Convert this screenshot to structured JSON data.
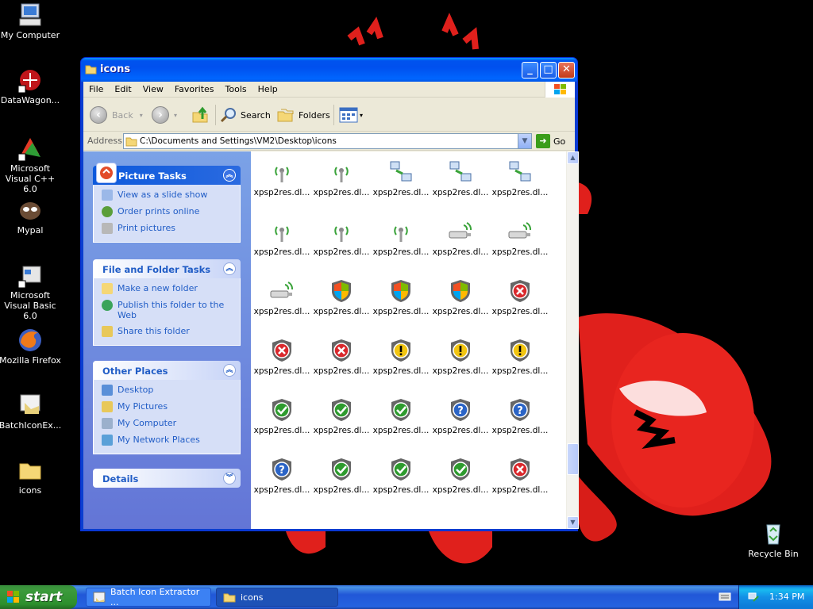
{
  "desktop": {
    "icons": [
      {
        "label": "My Computer"
      },
      {
        "label": "DataWagon..."
      },
      {
        "label": "Microsoft Visual C++ 6.0"
      },
      {
        "label": "Mypal"
      },
      {
        "label": "Microsoft Visual Basic 6.0"
      },
      {
        "label": "Mozilla Firefox"
      },
      {
        "label": "BatchIconEx..."
      },
      {
        "label": "icons"
      }
    ],
    "recycle_bin": "Recycle Bin"
  },
  "window": {
    "title": "icons",
    "menu": [
      "File",
      "Edit",
      "View",
      "Favorites",
      "Tools",
      "Help"
    ],
    "toolbar": {
      "back": "Back",
      "search": "Search",
      "folders": "Folders"
    },
    "address": {
      "label": "Address",
      "value": "C:\\Documents and Settings\\VM2\\Desktop\\icons",
      "go": "Go"
    }
  },
  "taskpane": {
    "picture_tasks": {
      "title": "Picture Tasks",
      "items": [
        "View as a slide show",
        "Order prints online",
        "Print pictures"
      ]
    },
    "file_folder_tasks": {
      "title": "File and Folder Tasks",
      "items": [
        "Make a new folder",
        "Publish this folder to the Web",
        "Share this folder"
      ]
    },
    "other_places": {
      "title": "Other Places",
      "items": [
        "Desktop",
        "My Pictures",
        "My Computer",
        "My Network Places"
      ]
    },
    "details": {
      "title": "Details"
    }
  },
  "files": {
    "label": "xpsp2res.dl...",
    "icon_kinds": [
      "antenna",
      "antenna",
      "network",
      "network",
      "network",
      "antenna",
      "antenna",
      "antenna",
      "usb-wireless",
      "usb-wireless",
      "usb-wireless",
      "shield-color",
      "shield-color",
      "shield-color",
      "shield-red",
      "shield-red",
      "shield-red",
      "shield-yellow",
      "shield-yellow",
      "shield-yellow",
      "shield-green",
      "shield-green",
      "shield-green",
      "shield-blue",
      "shield-blue",
      "shield-blue",
      "shield-green",
      "shield-green",
      "shield-green",
      "shield-red"
    ]
  },
  "taskbar": {
    "start": "start",
    "tasks": [
      "Batch Icon Extractor ...",
      "icons"
    ],
    "clock": "1:34 PM"
  },
  "colors": {
    "xp_blue": "#0a3ed0",
    "taskpane_link": "#215dc6",
    "start_green": "#388e3c"
  }
}
